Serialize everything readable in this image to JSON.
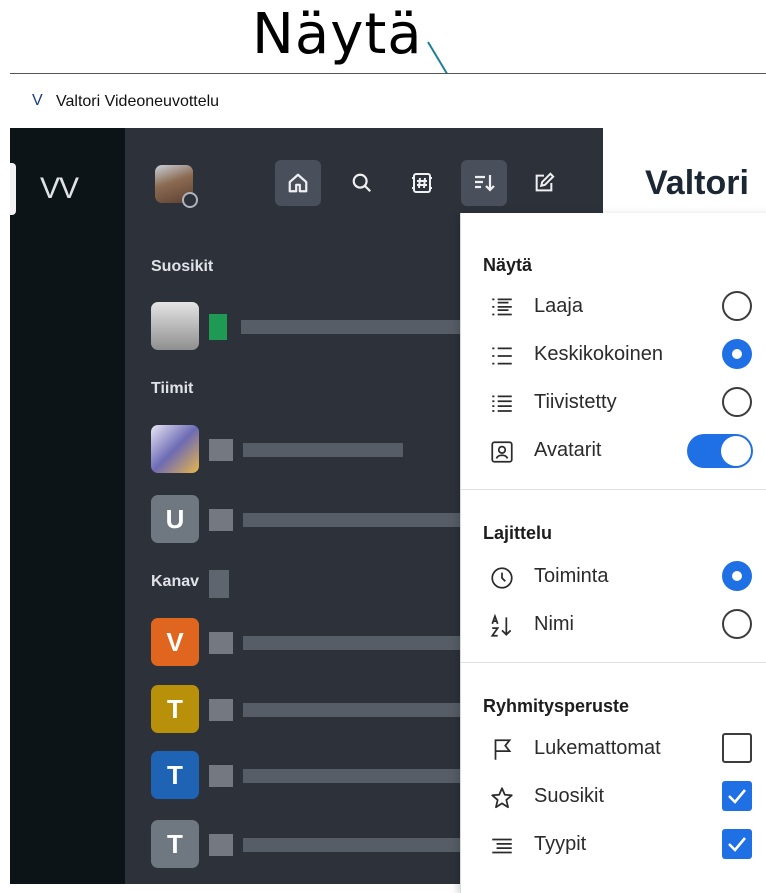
{
  "annotation": {
    "title": "Näytä"
  },
  "window": {
    "icon_letter": "V",
    "title": "Valtori Videoneuvottelu"
  },
  "rail": {
    "workspace_label": "VV"
  },
  "main": {
    "title": "Valtori"
  },
  "toolbar": {
    "icons": [
      "home-icon",
      "search-icon",
      "channel-icon",
      "sort-icon",
      "compose-icon"
    ],
    "active": "home-icon"
  },
  "sections": {
    "favorites": "Suosikit",
    "teams": "Tiimit",
    "channels": "Kanav"
  },
  "rows": {
    "team2_initial": "U",
    "channel1_initial": "V",
    "channel2_initial": "T",
    "channel3_initial": "T",
    "channel4_initial": "T"
  },
  "colors": {
    "accent": "#1f6fe5",
    "sidebar": "#2d3139",
    "rail": "#0d1418",
    "orange": "#e0661f",
    "gold": "#b9900a",
    "blue": "#1f63b5",
    "gray": "#6f7781"
  },
  "menu": {
    "view_header": "Näytä",
    "view_items": [
      {
        "label": "Laaja",
        "icon": "wide-list-icon",
        "selected": false
      },
      {
        "label": "Keskikokoinen",
        "icon": "medium-list-icon",
        "selected": true
      },
      {
        "label": "Tiivistetty",
        "icon": "compact-list-icon",
        "selected": false
      }
    ],
    "avatars_label": "Avatarit",
    "avatars_on": true,
    "sort_header": "Lajittelu",
    "sort_items": [
      {
        "label": "Toiminta",
        "icon": "clock-icon",
        "selected": true
      },
      {
        "label": "Nimi",
        "icon": "alpha-sort-icon",
        "selected": false
      }
    ],
    "group_header": "Ryhmitysperuste",
    "group_items": [
      {
        "label": "Lukemattomat",
        "icon": "flag-icon",
        "checked": false
      },
      {
        "label": "Suosikit",
        "icon": "star-icon",
        "checked": true
      },
      {
        "label": "Tyypit",
        "icon": "types-icon",
        "checked": true
      }
    ]
  }
}
